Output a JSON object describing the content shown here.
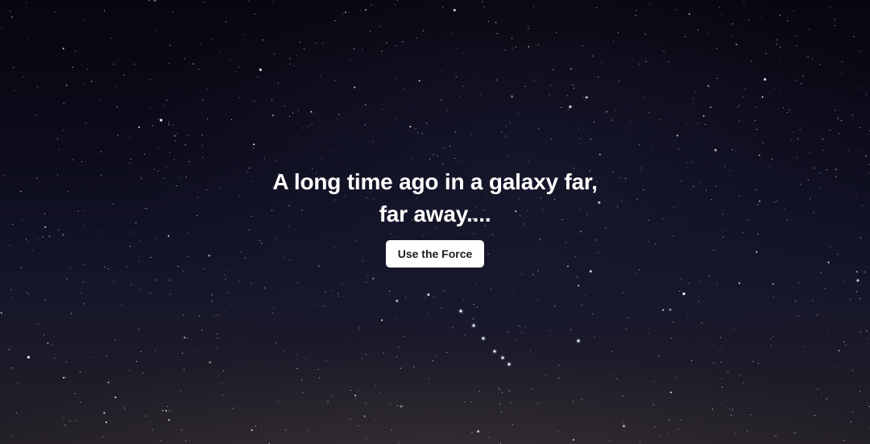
{
  "hero": {
    "headline_line1": "A long time ago in a galaxy far,",
    "headline_line2": "far away....",
    "button_label": "Use the Force"
  },
  "colors": {
    "text": "#ffffff",
    "button_background": "#ffffff",
    "button_text": "#1b1b1b",
    "sky_top": "#07070f",
    "sky_bottom": "#231f26"
  },
  "background": {
    "description": "night-sky-starfield"
  }
}
